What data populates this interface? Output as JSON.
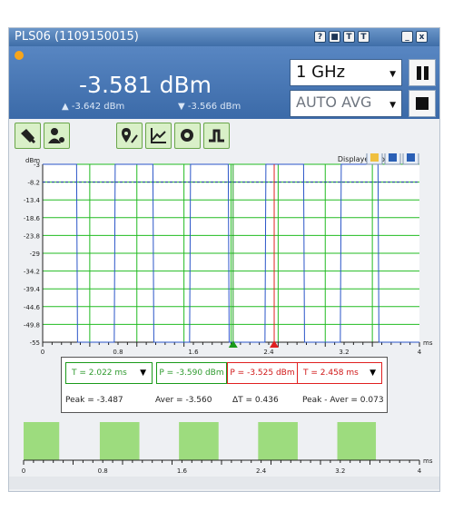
{
  "window": {
    "title": "PLS06 (1109150015)"
  },
  "title_buttons": [
    "?",
    "■",
    "T",
    "T",
    "_",
    "x"
  ],
  "header": {
    "main_value": "-3.581 dBm",
    "min_value": "-3.642 dBm",
    "max_value": "-3.566 dBm",
    "frequency": "1 GHz",
    "averaging": "AUTO AVG"
  },
  "toolbar_icons": [
    "zoom-icon",
    "settings-user-icon",
    "markers-icon",
    "chart-icon",
    "gear-icon",
    "step-icon"
  ],
  "plot": {
    "unit_label": "dBm",
    "displayed_points_label": "Displayed points: 940",
    "y_ticks": [
      "-3",
      "-8.2",
      "-13.4",
      "-18.6",
      "-23.8",
      "-29",
      "-34.2",
      "-39.4",
      "-44.6",
      "-49.8",
      "-55"
    ],
    "x_ticks": [
      "0",
      "0.8",
      "1.6",
      "2.4",
      "3.2",
      "4"
    ],
    "x_unit": "ms",
    "grid_color": "#22bb22",
    "trace_color": "#2a55c8"
  },
  "measurements": {
    "t1": "T = 2.022 ms",
    "p1": "P = -3.590 dBm",
    "p2": "P = -3.525 dBm",
    "t2": "T = 2.458 ms",
    "peak": "Peak = -3.487",
    "aver": "Aver = -3.560",
    "delta_t": "ΔT = 0.436",
    "peak_aver": "Peak - Aver = 0.073"
  },
  "overview": {
    "x_ticks": [
      "0",
      "0.8",
      "1.6",
      "2.4",
      "3.2",
      "4"
    ],
    "x_unit": "ms",
    "fill_color": "#9ddc7e"
  },
  "chart_data": [
    {
      "type": "line",
      "title": "",
      "xlabel": "ms",
      "ylabel": "dBm",
      "xlim": [
        0,
        4
      ],
      "ylim": [
        -55,
        -3
      ],
      "grid": true,
      "series": [
        {
          "x": [
            0,
            0.36,
            0.37,
            0.76,
            0.77,
            1.17,
            1.18,
            1.56,
            1.57,
            1.97,
            1.98,
            2.36,
            2.37,
            2.77,
            2.78,
            3.16,
            3.17,
            3.56,
            3.57,
            4.0
          ],
          "values": [
            -3,
            -3,
            -55,
            -55,
            -3,
            -3,
            -55,
            -55,
            -3,
            -3,
            -55,
            -55,
            -3,
            -3,
            -55,
            -55,
            -3,
            -3,
            -55,
            -55
          ]
        }
      ],
      "reference_line": -8.2,
      "markers": [
        2.022,
        2.458
      ]
    }
  ]
}
